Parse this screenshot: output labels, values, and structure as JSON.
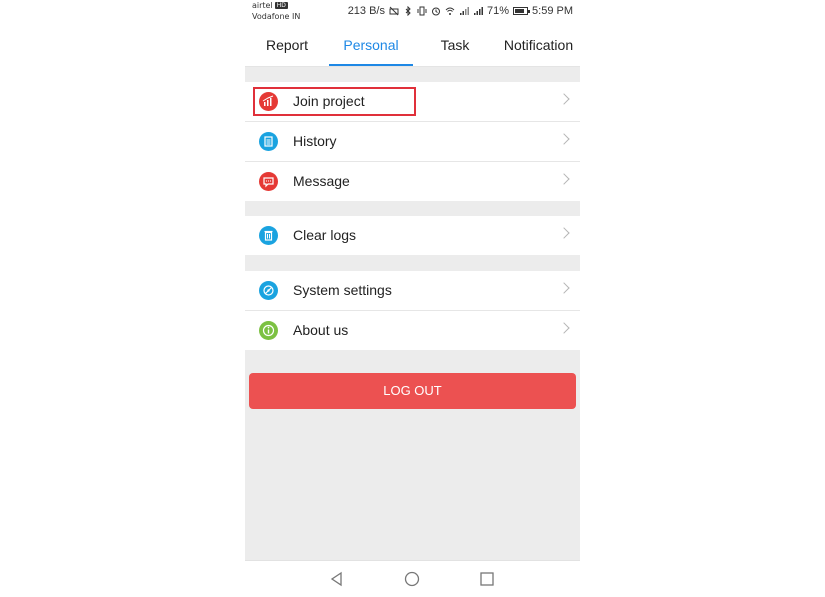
{
  "status_bar": {
    "carrier_primary": "airtel",
    "carrier_badge": "HD",
    "carrier_secondary": "Vodafone IN",
    "network_speed": "213 B/s",
    "battery_percent": "71%",
    "time": "5:59 PM"
  },
  "tabs": [
    {
      "label": "Report",
      "active": false
    },
    {
      "label": "Personal",
      "active": true
    },
    {
      "label": "Task",
      "active": false
    },
    {
      "label": "Notification",
      "active": false
    }
  ],
  "menu": {
    "group1": [
      {
        "label": "Join project",
        "icon": "join-project-icon",
        "color": "#e53935",
        "highlighted": true
      },
      {
        "label": "History",
        "icon": "history-icon",
        "color": "#1aa3e0"
      },
      {
        "label": "Message",
        "icon": "message-icon",
        "color": "#e53935"
      }
    ],
    "group2": [
      {
        "label": "Clear logs",
        "icon": "trash-icon",
        "color": "#1aa3e0"
      }
    ],
    "group3": [
      {
        "label": "System settings",
        "icon": "settings-icon",
        "color": "#1aa3e0"
      },
      {
        "label": "About us",
        "icon": "info-icon",
        "color": "#7cc142"
      }
    ]
  },
  "logout_label": "LOG OUT",
  "colors": {
    "accent": "#1e88e5",
    "logout": "#ec5151",
    "highlight": "#e0303a"
  }
}
